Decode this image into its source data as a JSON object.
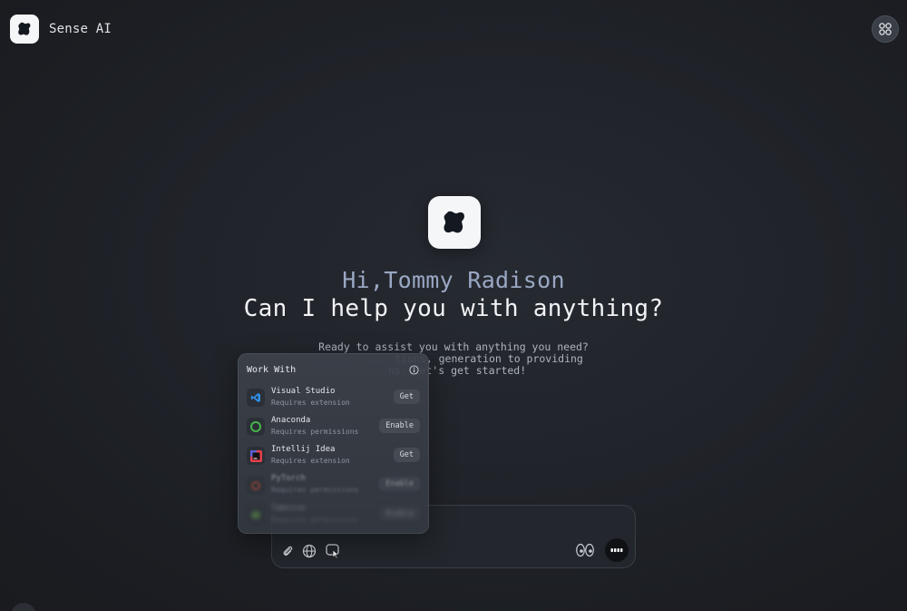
{
  "app": {
    "name": "Sense AI",
    "logo_icon": "sense-logo-icon",
    "apps_icon": "apps-grid-icon"
  },
  "hero": {
    "greeting": "Hi,Tommy Radison",
    "headline": "Can I help you with anything?",
    "subtext_line1": "Ready to assist you with anything you need?",
    "subtext_line2": "tions, generation to providing",
    "subtext_line3": "ns. Let's get started!"
  },
  "work_with": {
    "title": "Work With",
    "info_icon": "info-icon",
    "items": [
      {
        "name": "Visual Studio",
        "sub": "Requires extension",
        "action": "Get",
        "icon": "visual-studio-icon",
        "color": "#2f8fe6"
      },
      {
        "name": "Anaconda",
        "sub": "Requires permissions",
        "action": "Enable",
        "icon": "anaconda-icon",
        "color": "#44b549"
      },
      {
        "name": "Intellij Idea",
        "sub": "Requires extension",
        "action": "Get",
        "icon": "intellij-icon",
        "color": "#e8404f"
      },
      {
        "name": "PyTorch",
        "sub": "Requires permissions",
        "action": "Enable",
        "icon": "pytorch-icon",
        "color": "#ee4c2c"
      },
      {
        "name": "Tabnine",
        "sub": "Requires permissions",
        "action": "Enable",
        "icon": "tabnine-icon",
        "color": "#6dc24b"
      }
    ]
  },
  "chat": {
    "tools": [
      "attach-icon",
      "globe-icon",
      "work-with-icon"
    ],
    "voice_icon": "voice-eyes-icon",
    "send_icon": "send-dots-icon"
  }
}
